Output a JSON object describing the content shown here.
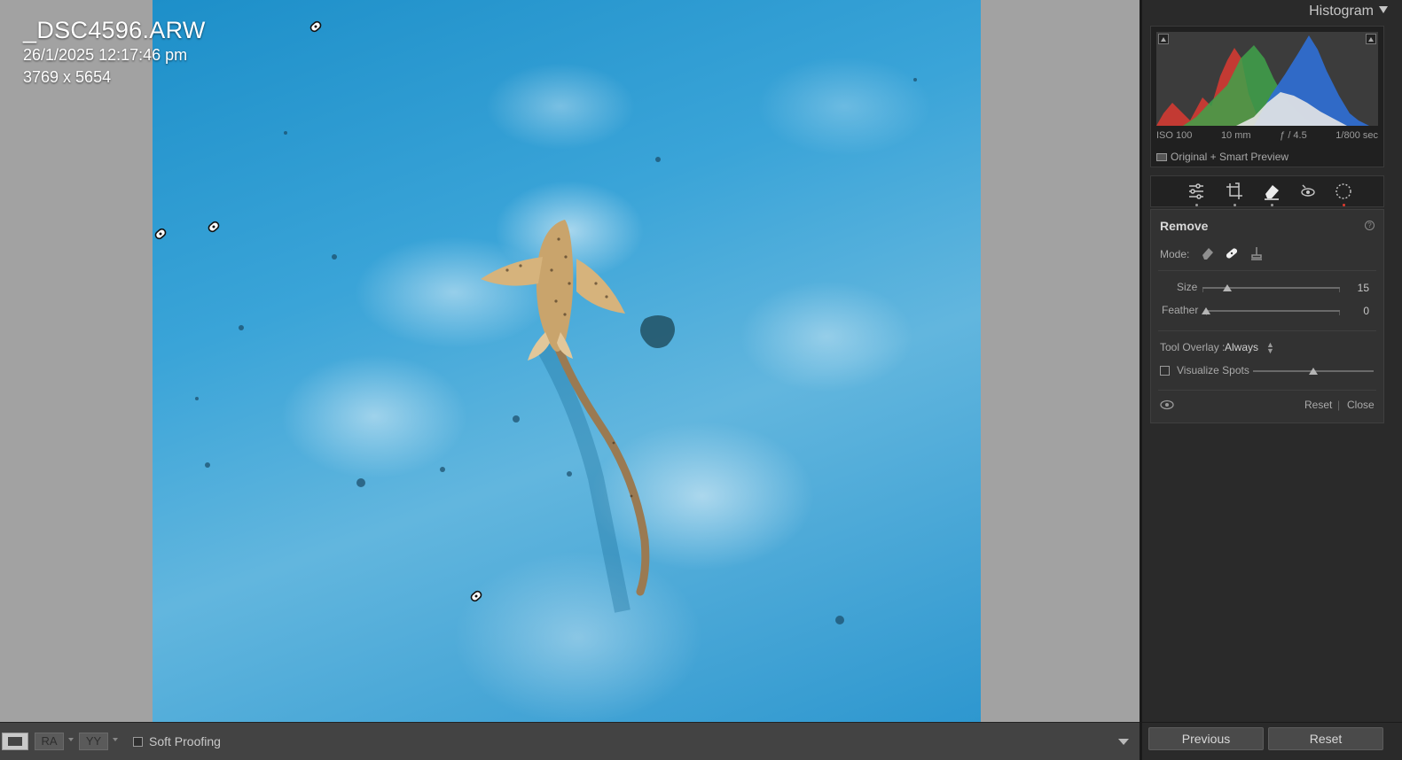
{
  "photo_info": {
    "filename": "_DSC4596.ARW",
    "datetime": "26/1/2025 12:17:46 pm",
    "dimensions": "3769 x 5654"
  },
  "toolbar": {
    "ra_label": "RA",
    "yy_label": "YY",
    "soft_proofing_label": "Soft Proofing",
    "soft_proofing_checked": false
  },
  "histogram": {
    "title": "Histogram",
    "iso": "ISO 100",
    "focal_length": "10 mm",
    "aperture": "ƒ / 4.5",
    "shutter": "1/800 sec",
    "preview_status": "Original + Smart Preview",
    "colors": {
      "red": "#d23a32",
      "green": "#3fa24a",
      "blue": "#2f6fd6",
      "white": "#e6e6e6"
    }
  },
  "tools": [
    "edit-sliders-icon",
    "crop-icon",
    "remove-eraser-icon",
    "red-eye-icon",
    "masking-icon"
  ],
  "remove_panel": {
    "title": "Remove",
    "mode_label": "Mode:",
    "size_label": "Size",
    "size_value": "15",
    "size_fraction": 0.18,
    "feather_label": "Feather",
    "feather_value": "0",
    "feather_fraction": 0.0,
    "tool_overlay_label": "Tool Overlay :",
    "tool_overlay_value": "Always",
    "visualize_spots_label": "Visualize Spots",
    "visualize_spots_checked": false,
    "visualize_fraction": 0.5,
    "reset_label": "Reset",
    "close_label": "Close"
  },
  "nav": {
    "previous_label": "Previous",
    "reset_label": "Reset"
  }
}
